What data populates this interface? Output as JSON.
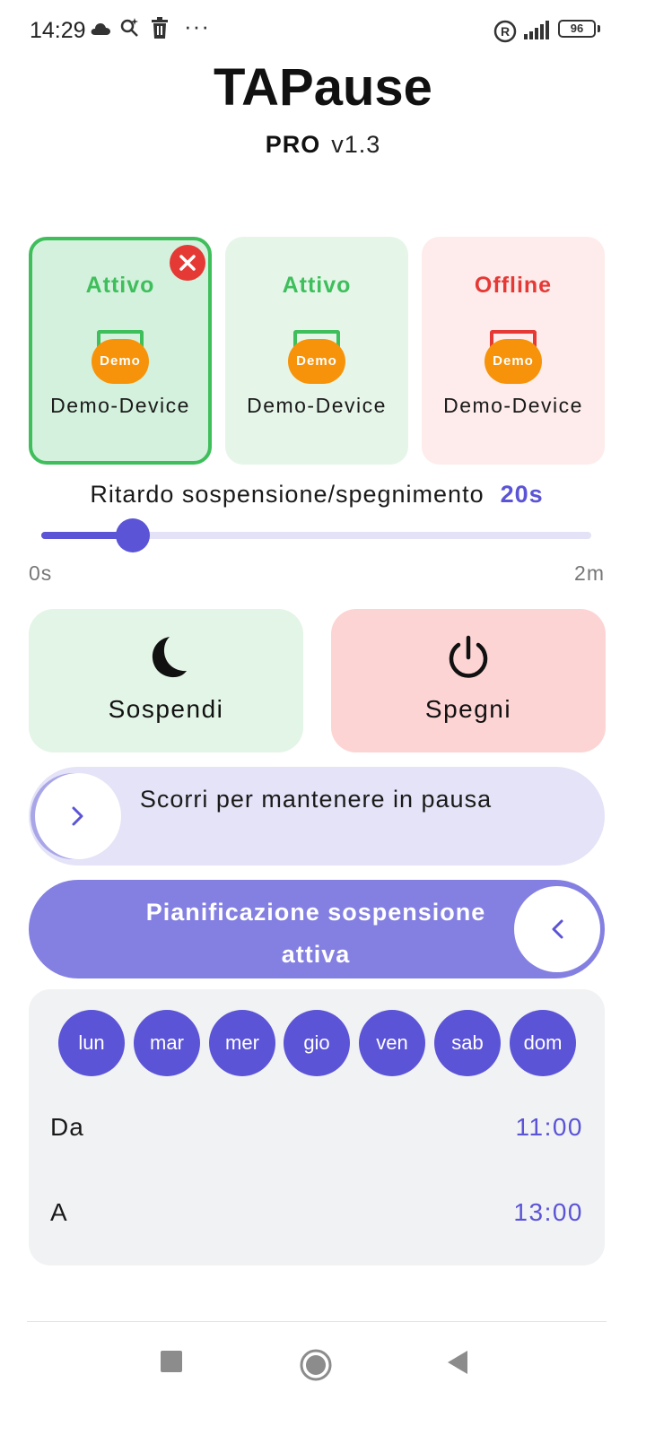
{
  "status_bar": {
    "time": "14:29",
    "icons": [
      "cloud-icon",
      "search-sparkle-icon",
      "trash-icon",
      "more-icon",
      "registered-icon",
      "signal-icon",
      "battery-icon"
    ],
    "more_dots": "···",
    "battery_level": "96"
  },
  "header": {
    "title": "TAPause",
    "edition": "PRO",
    "version": "v1.3"
  },
  "devices": [
    {
      "status": "Attivo",
      "badge": "Demo",
      "name": "Demo-Device",
      "status_color": "#3fbe5c",
      "selected": true
    },
    {
      "status": "Attivo",
      "badge": "Demo",
      "name": "Demo-Device",
      "status_color": "#3fbe5c",
      "selected": false
    },
    {
      "status": "Offline",
      "badge": "Demo",
      "name": "Demo-Device",
      "status_color": "#e53935",
      "selected": false
    }
  ],
  "delay": {
    "label": "Ritardo sospensione/spegnimento",
    "value": "20s",
    "fraction": 0.1667,
    "min_label": "0s",
    "max_label": "2m"
  },
  "actions": {
    "sleep_label": "Sospendi",
    "power_label": "Spegni"
  },
  "swipe_pause": {
    "text": "Scorri per mantenere in pausa"
  },
  "schedule": {
    "toggle_text": "Pianificazione sospensione attiva",
    "days": [
      "lun",
      "mar",
      "mer",
      "gio",
      "ven",
      "sab",
      "dom"
    ],
    "from_label": "Da",
    "from_value": "11:00",
    "to_label": "A",
    "to_value": "13:00"
  },
  "colors": {
    "accent": "#5b54d6",
    "active_green": "#3fbe5c",
    "offline_red": "#e53935",
    "demo_orange": "#f7930a"
  }
}
